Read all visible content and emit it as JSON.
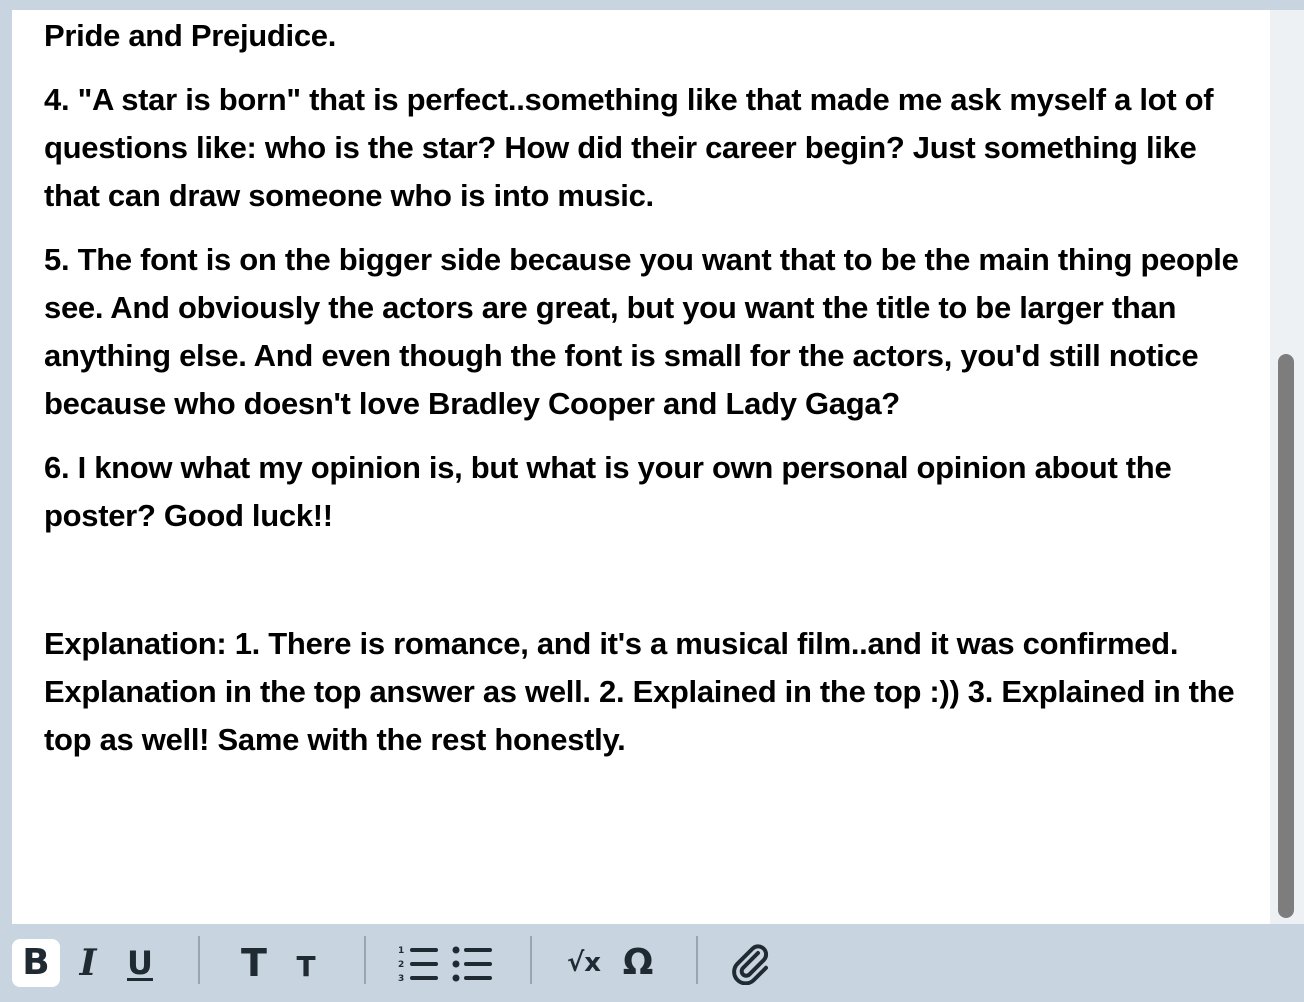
{
  "editor": {
    "paragraphs": [
      "Pride and Prejudice.",
      "4. \"A star is born\" that is perfect..something like that made me ask myself a lot of questions like: who is the star? How did their career begin? Just something like that can draw someone who is into music.",
      "5. The font is on the bigger side because you want that to be the main thing people see. And obviously the actors are great, but you want the title to be larger than anything else. And even though the font is small for the actors, you'd still notice because who doesn't love Bradley Cooper and Lady Gaga?",
      "6. I know what my opinion is, but what is your own personal opinion about the poster? Good luck!!",
      "",
      "Explanation: 1. There is romance, and it's a musical film..and it was confirmed. Explanation in the top answer as well. 2. Explained in the top :)) 3. Explained in the top as well! Same with the rest honestly."
    ]
  },
  "toolbar": {
    "tools": [
      {
        "name": "bold-button",
        "icon": "bold-icon",
        "glyph": "B",
        "active": true
      },
      {
        "name": "italic-button",
        "icon": "italic-icon",
        "glyph": "I",
        "active": false
      },
      {
        "name": "underline-button",
        "icon": "underline-icon",
        "glyph": "U",
        "active": false
      },
      {
        "name": "heading-large-button",
        "icon": "text-size-large-icon",
        "glyph": "T",
        "active": false
      },
      {
        "name": "heading-small-button",
        "icon": "text-size-small-icon",
        "glyph": "T",
        "active": false
      },
      {
        "name": "numbered-list-button",
        "icon": "numbered-list-icon",
        "glyph": "",
        "active": false
      },
      {
        "name": "bulleted-list-button",
        "icon": "bulleted-list-icon",
        "glyph": "",
        "active": false
      },
      {
        "name": "equation-button",
        "icon": "square-root-icon",
        "glyph": "√x",
        "active": false
      },
      {
        "name": "special-character-button",
        "icon": "omega-icon",
        "glyph": "Ω",
        "active": false
      },
      {
        "name": "attach-button",
        "icon": "paperclip-icon",
        "glyph": "",
        "active": false
      }
    ]
  },
  "colors": {
    "toolbar_bg": "#c8d4df",
    "editor_bg": "#ffffff",
    "text": "#000000",
    "icon": "#1f2a33",
    "scrollbar_thumb": "#7d7d7d"
  }
}
